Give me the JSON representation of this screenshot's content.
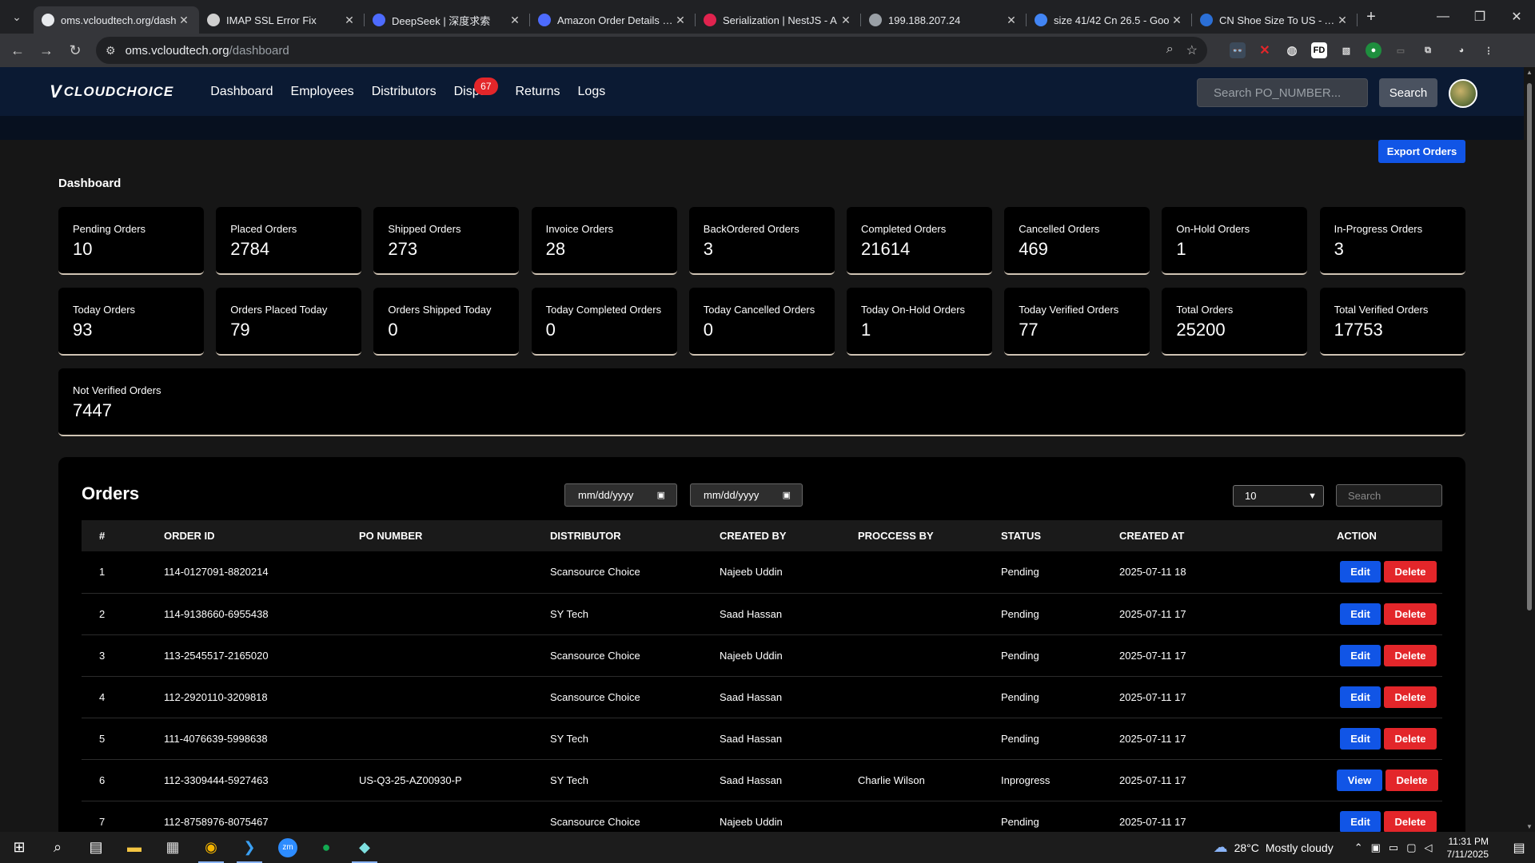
{
  "browser": {
    "tabs": [
      {
        "title": "oms.vcloudtech.org/dash",
        "favicon_color": "#e8eaed",
        "active": true
      },
      {
        "title": "IMAP SSL Error Fix",
        "favicon_color": "#cfcfcf"
      },
      {
        "title": "DeepSeek | 深度求索",
        "favicon_color": "#4d6bfe"
      },
      {
        "title": "Amazon Order Details for",
        "favicon_color": "#4d6bfe"
      },
      {
        "title": "Serialization | NestJS - A",
        "favicon_color": "#e0234e"
      },
      {
        "title": "199.188.207.24",
        "favicon_color": "#9aa0a6"
      },
      {
        "title": "size 41/42 Cn 26.5 - Goo",
        "favicon_color": "#4285f4"
      },
      {
        "title": "CN Shoe Size To US - A T",
        "favicon_color": "#2b6fd6"
      }
    ],
    "url_host": "oms.vcloudtech.org",
    "url_path": "/dashboard"
  },
  "app": {
    "logo": "CLOUDCHOICE",
    "nav": [
      "Dashboard",
      "Employees",
      "Distributors",
      "Dispu",
      "Returns",
      "Logs"
    ],
    "disputes_badge": "67",
    "search_placeholder": "Search PO_NUMBER...",
    "search_button": "Search",
    "export_button": "Export Orders",
    "dashboard_title": "Dashboard"
  },
  "stats": [
    {
      "label": "Pending Orders",
      "value": "10"
    },
    {
      "label": "Placed Orders",
      "value": "2784"
    },
    {
      "label": "Shipped Orders",
      "value": "273"
    },
    {
      "label": "Invoice Orders",
      "value": "28"
    },
    {
      "label": "BackOrdered Orders",
      "value": "3"
    },
    {
      "label": "Completed Orders",
      "value": "21614"
    },
    {
      "label": "Cancelled Orders",
      "value": "469"
    },
    {
      "label": "On-Hold Orders",
      "value": "1"
    },
    {
      "label": "In-Progress Orders",
      "value": "3"
    },
    {
      "label": "Today Orders",
      "value": "93"
    },
    {
      "label": "Orders Placed Today",
      "value": "79"
    },
    {
      "label": "Orders Shipped Today",
      "value": "0"
    },
    {
      "label": "Today Completed Orders",
      "value": "0"
    },
    {
      "label": "Today Cancelled Orders",
      "value": "0"
    },
    {
      "label": "Today On-Hold Orders",
      "value": "1"
    },
    {
      "label": "Today Verified Orders",
      "value": "77"
    },
    {
      "label": "Total Orders",
      "value": "25200"
    },
    {
      "label": "Total Verified Orders",
      "value": "17753"
    },
    {
      "label": "Not Verified Orders",
      "value": "7447"
    }
  ],
  "orders": {
    "title": "Orders",
    "date_from_placeholder": "mm/dd/yyyy",
    "date_to_placeholder": "mm/dd/yyyy",
    "page_size": "10",
    "search_placeholder": "Search",
    "columns": [
      "#",
      "ORDER ID",
      "PO NUMBER",
      "DISTRIBUTOR",
      "CREATED BY",
      "PROCCESS BY",
      "STATUS",
      "CREATED AT",
      "ACTION"
    ],
    "rows": [
      {
        "n": "1",
        "order_id": "114-0127091-8820214",
        "po": "",
        "distributor": "Scansource Choice",
        "created_by": "Najeeb Uddin",
        "process_by": "",
        "status": "Pending",
        "created_at": "2025-07-11 18",
        "primary_action": "Edit",
        "delete": "Delete"
      },
      {
        "n": "2",
        "order_id": "114-9138660-6955438",
        "po": "",
        "distributor": "SY Tech",
        "created_by": "Saad Hassan",
        "process_by": "",
        "status": "Pending",
        "created_at": "2025-07-11 17",
        "primary_action": "Edit",
        "delete": "Delete"
      },
      {
        "n": "3",
        "order_id": "113-2545517-2165020",
        "po": "",
        "distributor": "Scansource Choice",
        "created_by": "Najeeb Uddin",
        "process_by": "",
        "status": "Pending",
        "created_at": "2025-07-11 17",
        "primary_action": "Edit",
        "delete": "Delete"
      },
      {
        "n": "4",
        "order_id": "112-2920110-3209818",
        "po": "",
        "distributor": "Scansource Choice",
        "created_by": "Saad Hassan",
        "process_by": "",
        "status": "Pending",
        "created_at": "2025-07-11 17",
        "primary_action": "Edit",
        "delete": "Delete"
      },
      {
        "n": "5",
        "order_id": "111-4076639-5998638",
        "po": "",
        "distributor": "SY Tech",
        "created_by": "Saad Hassan",
        "process_by": "",
        "status": "Pending",
        "created_at": "2025-07-11 17",
        "primary_action": "Edit",
        "delete": "Delete"
      },
      {
        "n": "6",
        "order_id": "112-3309444-5927463",
        "po": "US-Q3-25-AZ00930-P",
        "distributor": "SY Tech",
        "created_by": "Saad Hassan",
        "process_by": "Charlie Wilson",
        "status": "Inprogress",
        "created_at": "2025-07-11 17",
        "primary_action": "View",
        "delete": "Delete"
      },
      {
        "n": "7",
        "order_id": "112-8758976-8075467",
        "po": "",
        "distributor": "Scansource Choice",
        "created_by": "Najeeb Uddin",
        "process_by": "",
        "status": "Pending",
        "created_at": "2025-07-11 17",
        "primary_action": "Edit",
        "delete": "Delete"
      }
    ]
  },
  "taskbar": {
    "temperature": "28°C",
    "weather": "Mostly cloudy",
    "time": "11:31 PM",
    "date": "7/11/2025"
  }
}
